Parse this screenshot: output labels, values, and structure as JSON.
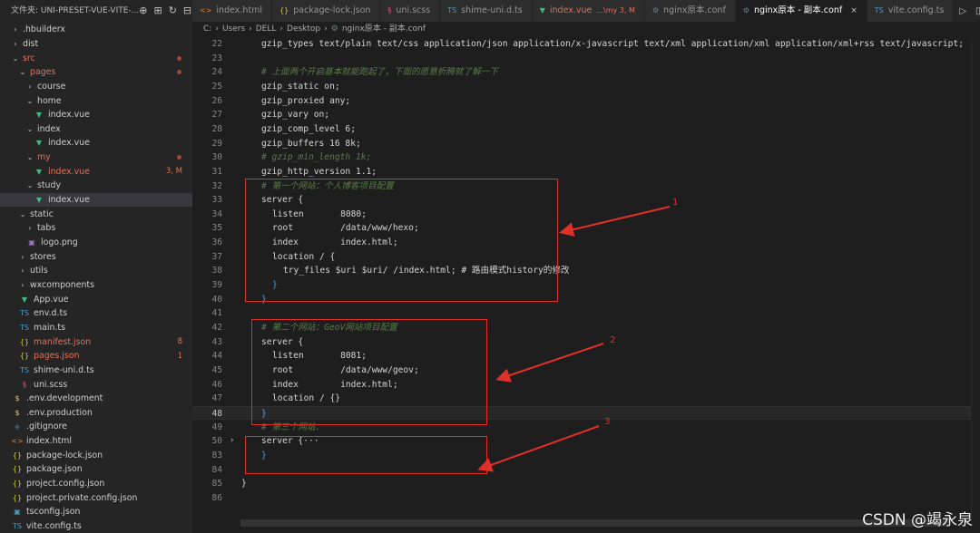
{
  "explorer": {
    "title": "文件夹: UNI-PRESET-VUE-VITE-..."
  },
  "tree": [
    {
      "label": ".hbuilderx",
      "kind": "folder",
      "open": false,
      "indent": 0
    },
    {
      "label": "dist",
      "kind": "folder",
      "open": false,
      "indent": 0
    },
    {
      "label": "src",
      "kind": "folder",
      "open": true,
      "indent": 0,
      "color": "#e2705a",
      "dot": true
    },
    {
      "label": "pages",
      "kind": "folder",
      "open": true,
      "indent": 1,
      "color": "#e2705a",
      "dot": true
    },
    {
      "label": "course",
      "kind": "folder",
      "open": false,
      "indent": 2
    },
    {
      "label": "home",
      "kind": "folder",
      "open": true,
      "indent": 2
    },
    {
      "label": "index.vue",
      "kind": "vue",
      "indent": 3
    },
    {
      "label": "index",
      "kind": "folder",
      "open": true,
      "indent": 2
    },
    {
      "label": "index.vue",
      "kind": "vue",
      "indent": 3
    },
    {
      "label": "my",
      "kind": "folder",
      "open": true,
      "indent": 2,
      "color": "#e2705a",
      "dot": true
    },
    {
      "label": "index.vue",
      "kind": "vue",
      "indent": 3,
      "color": "#e2705a",
      "badge": "3, M"
    },
    {
      "label": "study",
      "kind": "folder",
      "open": true,
      "indent": 2
    },
    {
      "label": "index.vue",
      "kind": "vue",
      "indent": 3,
      "selected": true
    },
    {
      "label": "static",
      "kind": "folder",
      "open": true,
      "indent": 1
    },
    {
      "label": "tabs",
      "kind": "folder",
      "open": false,
      "indent": 2
    },
    {
      "label": "logo.png",
      "kind": "img",
      "indent": 2
    },
    {
      "label": "stores",
      "kind": "folder",
      "open": false,
      "indent": 1
    },
    {
      "label": "utils",
      "kind": "folder",
      "open": false,
      "indent": 1
    },
    {
      "label": "wxcomponents",
      "kind": "folder",
      "open": false,
      "indent": 1
    },
    {
      "label": "App.vue",
      "kind": "vue",
      "indent": 1
    },
    {
      "label": "env.d.ts",
      "kind": "ts",
      "indent": 1
    },
    {
      "label": "main.ts",
      "kind": "ts",
      "indent": 1
    },
    {
      "label": "manifest.json",
      "kind": "json",
      "indent": 1,
      "color": "#e2705a",
      "badge": "8"
    },
    {
      "label": "pages.json",
      "kind": "json",
      "indent": 1,
      "color": "#e2705a",
      "badge": "1"
    },
    {
      "label": "shime-uni.d.ts",
      "kind": "ts",
      "indent": 1
    },
    {
      "label": "uni.scss",
      "kind": "scss",
      "indent": 1
    },
    {
      "label": ".env.development",
      "kind": "env",
      "indent": 0
    },
    {
      "label": ".env.production",
      "kind": "env",
      "indent": 0
    },
    {
      "label": ".gitignore",
      "kind": "git",
      "indent": 0
    },
    {
      "label": "index.html",
      "kind": "html",
      "indent": 0
    },
    {
      "label": "package-lock.json",
      "kind": "json",
      "indent": 0
    },
    {
      "label": "package.json",
      "kind": "json",
      "indent": 0
    },
    {
      "label": "project.config.json",
      "kind": "json",
      "indent": 0
    },
    {
      "label": "project.private.config.json",
      "kind": "json",
      "indent": 0
    },
    {
      "label": "tsconfig.json",
      "kind": "tsjson",
      "indent": 0
    },
    {
      "label": "vite.config.ts",
      "kind": "ts",
      "indent": 0
    }
  ],
  "tabs": [
    {
      "label": "index.html",
      "kind": "html"
    },
    {
      "label": "package-lock.json",
      "kind": "json"
    },
    {
      "label": "uni.scss",
      "kind": "scss"
    },
    {
      "label": "shime-uni.d.ts",
      "kind": "ts"
    },
    {
      "label": "index.vue",
      "kind": "vue",
      "extra": "...\\my 3, M",
      "color": "#e2705a"
    },
    {
      "label": "nginx原本.conf",
      "kind": "gear"
    },
    {
      "label": "nginx原本 - 副本.conf",
      "kind": "gear",
      "active": true
    },
    {
      "label": "vite.config.ts",
      "kind": "ts"
    }
  ],
  "breadcrumb": [
    "C:",
    "Users",
    "DELL",
    "Desktop",
    "nginx原本 - 副本.conf"
  ],
  "code_lines": [
    {
      "n": "22",
      "t": "gzip_types text/plain text/css application/json application/x-javascript text/xml application/xml application/xml+rss text/javascript;",
      "cls": "c-val",
      "ind": 0
    },
    {
      "n": "23",
      "t": "",
      "ind": 0
    },
    {
      "n": "24",
      "t": "# 上面两个开启基本就能跑起了，下面的愿意折腾就了解一下",
      "cls": "c-com",
      "ind": 0
    },
    {
      "n": "25",
      "t": "gzip_static on;",
      "cls": "c-val",
      "ind": 0
    },
    {
      "n": "26",
      "t": "gzip_proxied any;",
      "cls": "c-val",
      "ind": 0
    },
    {
      "n": "27",
      "t": "gzip_vary on;",
      "cls": "c-val",
      "ind": 0
    },
    {
      "n": "28",
      "t": "gzip_comp_level 6;",
      "cls": "c-val",
      "ind": 0
    },
    {
      "n": "29",
      "t": "gzip_buffers 16 8k;",
      "cls": "c-val",
      "ind": 0
    },
    {
      "n": "30",
      "t": "# gzip_min_length 1k;",
      "cls": "c-com",
      "ind": 0
    },
    {
      "n": "31",
      "t": "gzip_http_version 1.1;",
      "cls": "c-val",
      "ind": 0
    },
    {
      "n": "32",
      "t": "# 第一个网站：个人博客项目配置",
      "cls": "c-com",
      "ind": 0
    },
    {
      "n": "33",
      "t": "server {",
      "cls": "c-val",
      "ind": 0
    },
    {
      "n": "34",
      "t": "listen       8080;",
      "cls": "c-val",
      "ind": 1
    },
    {
      "n": "35",
      "t": "root         /data/www/hexo;",
      "cls": "c-val",
      "ind": 1
    },
    {
      "n": "36",
      "t": "index        index.html;",
      "cls": "c-val",
      "ind": 1
    },
    {
      "n": "37",
      "t": "location / {",
      "cls": "c-val",
      "ind": 1
    },
    {
      "n": "38",
      "t": "try_files $uri $uri/ /index.html; # 路由模式history的修改",
      "cls": "c-val",
      "ind": 2
    },
    {
      "n": "39",
      "t": "}",
      "cls": "c-br",
      "ind": 1
    },
    {
      "n": "40",
      "t": "}",
      "cls": "c-br",
      "ind": 0
    },
    {
      "n": "41",
      "t": "",
      "ind": 0
    },
    {
      "n": "42",
      "t": "# 第二个网站：GeoV网站项目配置",
      "cls": "c-com",
      "ind": 0
    },
    {
      "n": "43",
      "t": "server {",
      "cls": "c-val",
      "ind": 0
    },
    {
      "n": "44",
      "t": "listen       8081;",
      "cls": "c-val",
      "ind": 1
    },
    {
      "n": "45",
      "t": "root         /data/www/geov;",
      "cls": "c-val",
      "ind": 1
    },
    {
      "n": "46",
      "t": "index        index.html;",
      "cls": "c-val",
      "ind": 1
    },
    {
      "n": "47",
      "t": "location / {}",
      "cls": "c-val",
      "ind": 1
    },
    {
      "n": "48",
      "t": "}",
      "cls": "c-br",
      "ind": 0,
      "cur": true
    },
    {
      "n": "49",
      "t": "# 第三个网站：",
      "cls": "c-com",
      "ind": 0
    },
    {
      "n": "50",
      "t": "server {···",
      "cls": "c-val",
      "ind": 0,
      "fold": true
    },
    {
      "n": "83",
      "t": "}",
      "cls": "c-br",
      "ind": 0
    },
    {
      "n": "84",
      "t": "",
      "ind": 0
    },
    {
      "n": "85",
      "t": "}",
      "cls": "c-val",
      "ind": -1
    },
    {
      "n": "86",
      "t": "",
      "ind": 0
    }
  ],
  "annotations": [
    "1",
    "2",
    "3"
  ],
  "watermark": "CSDN @竭永泉",
  "colors": {
    "accent_red": "#e0302a",
    "modified": "#e2705a",
    "vue": "#41b883",
    "ts": "#519aba",
    "json": "#cbcb41"
  }
}
